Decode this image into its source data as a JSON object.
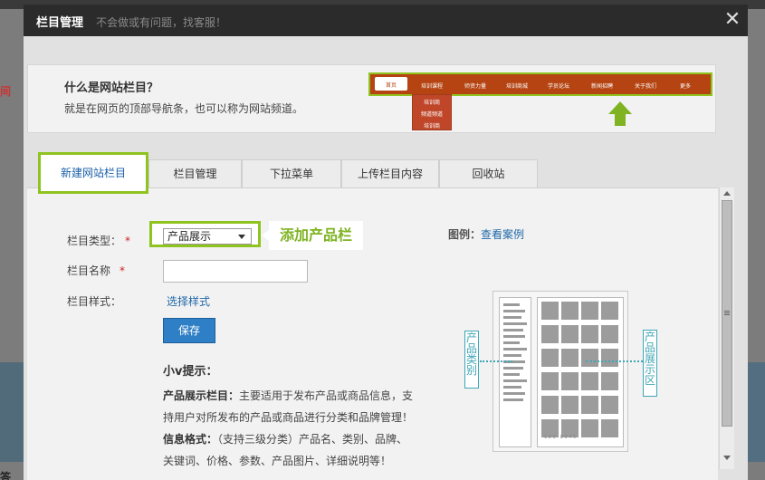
{
  "background": {
    "left_text_top": "间",
    "left_text_bottom": "答"
  },
  "dialog": {
    "title": "栏目管理",
    "subtitle": "不会做或有问题，找客服！",
    "close_icon": "close-icon"
  },
  "intro": {
    "title": "什么是网站栏目？",
    "description": "就是在网页的顶部导航条，也可以称为网站频道。",
    "nav_demo": [
      "首页",
      "培训课程",
      "师资力量",
      "培训商城",
      "学员论坛",
      "新闻招聘",
      "关于我们",
      "更多"
    ],
    "sub_demo": [
      "培训商",
      "频道频道",
      "培训商"
    ],
    "accent_color": "#8fc31f",
    "nav_color": "#b54412"
  },
  "tabs": [
    {
      "label": "新建网站栏目",
      "active": true
    },
    {
      "label": "栏目管理",
      "active": false
    },
    {
      "label": "下拉菜单",
      "active": false
    },
    {
      "label": "上传栏目内容",
      "active": false
    },
    {
      "label": "回收站",
      "active": false
    }
  ],
  "form": {
    "type_label": "栏目类型：",
    "type_value": "产品展示",
    "name_label": "栏目名称",
    "name_value": "",
    "style_label": "栏目样式：",
    "style_link": "选择样式",
    "save_label": "保存",
    "required_mark": "*",
    "callout": "添加产品栏"
  },
  "tips": {
    "title": "小v提示：",
    "line1_bold": "产品展示栏目：",
    "line1_rest": "主要适用于发布产品或商品信息，支",
    "line2": "持用户对所发布的产品或商品进行分类和品牌管理！",
    "line3_bold": "信息格式：",
    "line3_rest": "（支持三级分类）产品名、类别、品牌、",
    "line4": "关键词、价格、参数、产品图片、详细说明等！"
  },
  "legend": {
    "label": "图例：",
    "link": "查看案例"
  },
  "example": {
    "left_label": "产品类别",
    "right_label": "产品展示区",
    "footer": "1 2 3 - 8 9 4 5"
  }
}
